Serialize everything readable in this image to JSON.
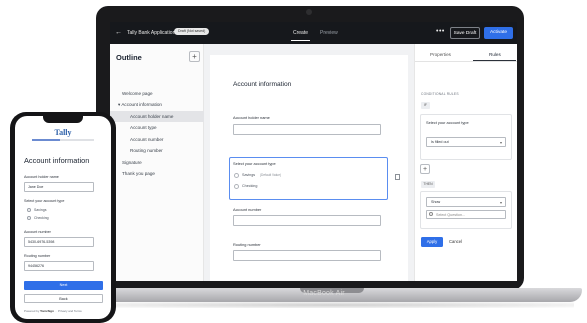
{
  "laptop": {
    "model_label": "MacBook Air"
  },
  "topbar": {
    "back_glyph": "←",
    "app_title": "Tally Bank Application",
    "draft_badge": "Draft (Not saved)",
    "tab_create": "Create",
    "tab_preview": "Preview",
    "more_glyph": "•••",
    "save_draft": "Save Draft",
    "activate": "Activate"
  },
  "outline": {
    "title": "Outline",
    "add_glyph": "+",
    "items": [
      {
        "label": "Welcome page"
      },
      {
        "label": "▾  Account information"
      },
      {
        "label": "Account holder name",
        "active": true
      },
      {
        "label": "Account type"
      },
      {
        "label": "Account number"
      },
      {
        "label": "Routing number"
      },
      {
        "label": "Signature"
      },
      {
        "label": "Thank you page"
      }
    ]
  },
  "form": {
    "title": "Account information",
    "holder_label": "Account holder name",
    "type_label": "Select your account type",
    "option_savings": "Savings",
    "option_savings_note": "(Default Value)",
    "option_checking": "Checking",
    "number_label": "Account number",
    "routing_label": "Routing number"
  },
  "rules_panel": {
    "tab_properties": "Properties",
    "tab_rules": "Rules",
    "section_conditional": "CONDITIONAL RULES",
    "if_tag": "IF",
    "condition_label": "Select your account type",
    "condition_value": "Is filled out",
    "add_glyph": "+",
    "then_tag": "THEN",
    "action_value": "Show",
    "search_placeholder": "Select Question...",
    "caret_glyph": "▾",
    "apply": "Apply",
    "cancel": "Cancel"
  },
  "phone": {
    "logo": "Tally",
    "progress": 0.45,
    "title": "Account information",
    "holder_label": "Account holder name",
    "holder_value": "Jane Doe",
    "type_label": "Select your account type",
    "option_savings": "Savings",
    "option_checking": "Checking",
    "number_label": "Account number",
    "number_value": "5430-6976-5398",
    "routing_label": "Routing number",
    "routing_value": "94456276",
    "next": "Next",
    "back": "Back",
    "footer_prefix": "Powered by",
    "footer_brand": "TonicSign",
    "footer_links": "Privacy and Terms"
  },
  "colors": {
    "accent": "#2f6fe8",
    "topbar_bg": "#16181c",
    "canvas_bg": "#f1f2f4",
    "logo": "#2c5fa8"
  }
}
